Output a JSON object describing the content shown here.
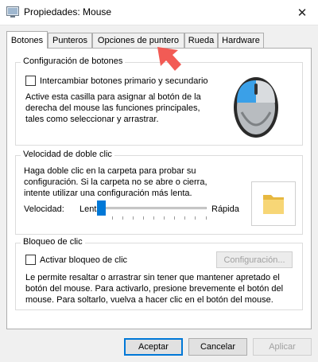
{
  "window": {
    "title": "Propiedades: Mouse",
    "close_glyph": "✕"
  },
  "tabs": [
    {
      "label": "Botones",
      "active": true
    },
    {
      "label": "Punteros",
      "active": false
    },
    {
      "label": "Opciones de puntero",
      "active": false
    },
    {
      "label": "Rueda",
      "active": false
    },
    {
      "label": "Hardware",
      "active": false
    }
  ],
  "button_config": {
    "title": "Configuración de botones",
    "checkbox_label": "Intercambiar botones primario y secundario",
    "checked": false,
    "description": "Active esta casilla para asignar al botón de la derecha del mouse las funciones principales, tales como seleccionar y arrastrar."
  },
  "double_click": {
    "title": "Velocidad de doble clic",
    "description": "Haga doble clic en la carpeta para probar su configuración. Si la carpeta no se abre o cierra, intente utilizar una configuración más lenta.",
    "speed_label": "Velocidad:",
    "slow_label": "Lenta",
    "fast_label": "Rápida",
    "speed_level": 0.0
  },
  "click_lock": {
    "title": "Bloqueo de clic",
    "checkbox_label": "Activar bloqueo de clic",
    "checked": false,
    "settings_button": "Configuración...",
    "description": "Le permite resaltar o arrastrar sin tener que mantener apretado el botón del mouse. Para activarlo, presione brevemente el botón del mouse. Para soltarlo, vuelva a hacer clic en el botón del mouse."
  },
  "footer": {
    "ok": "Aceptar",
    "cancel": "Cancelar",
    "apply": "Aplicar"
  },
  "colors": {
    "accent": "#0078d7",
    "annotation_arrow": "#f25b55",
    "folder": "#f7d676"
  }
}
